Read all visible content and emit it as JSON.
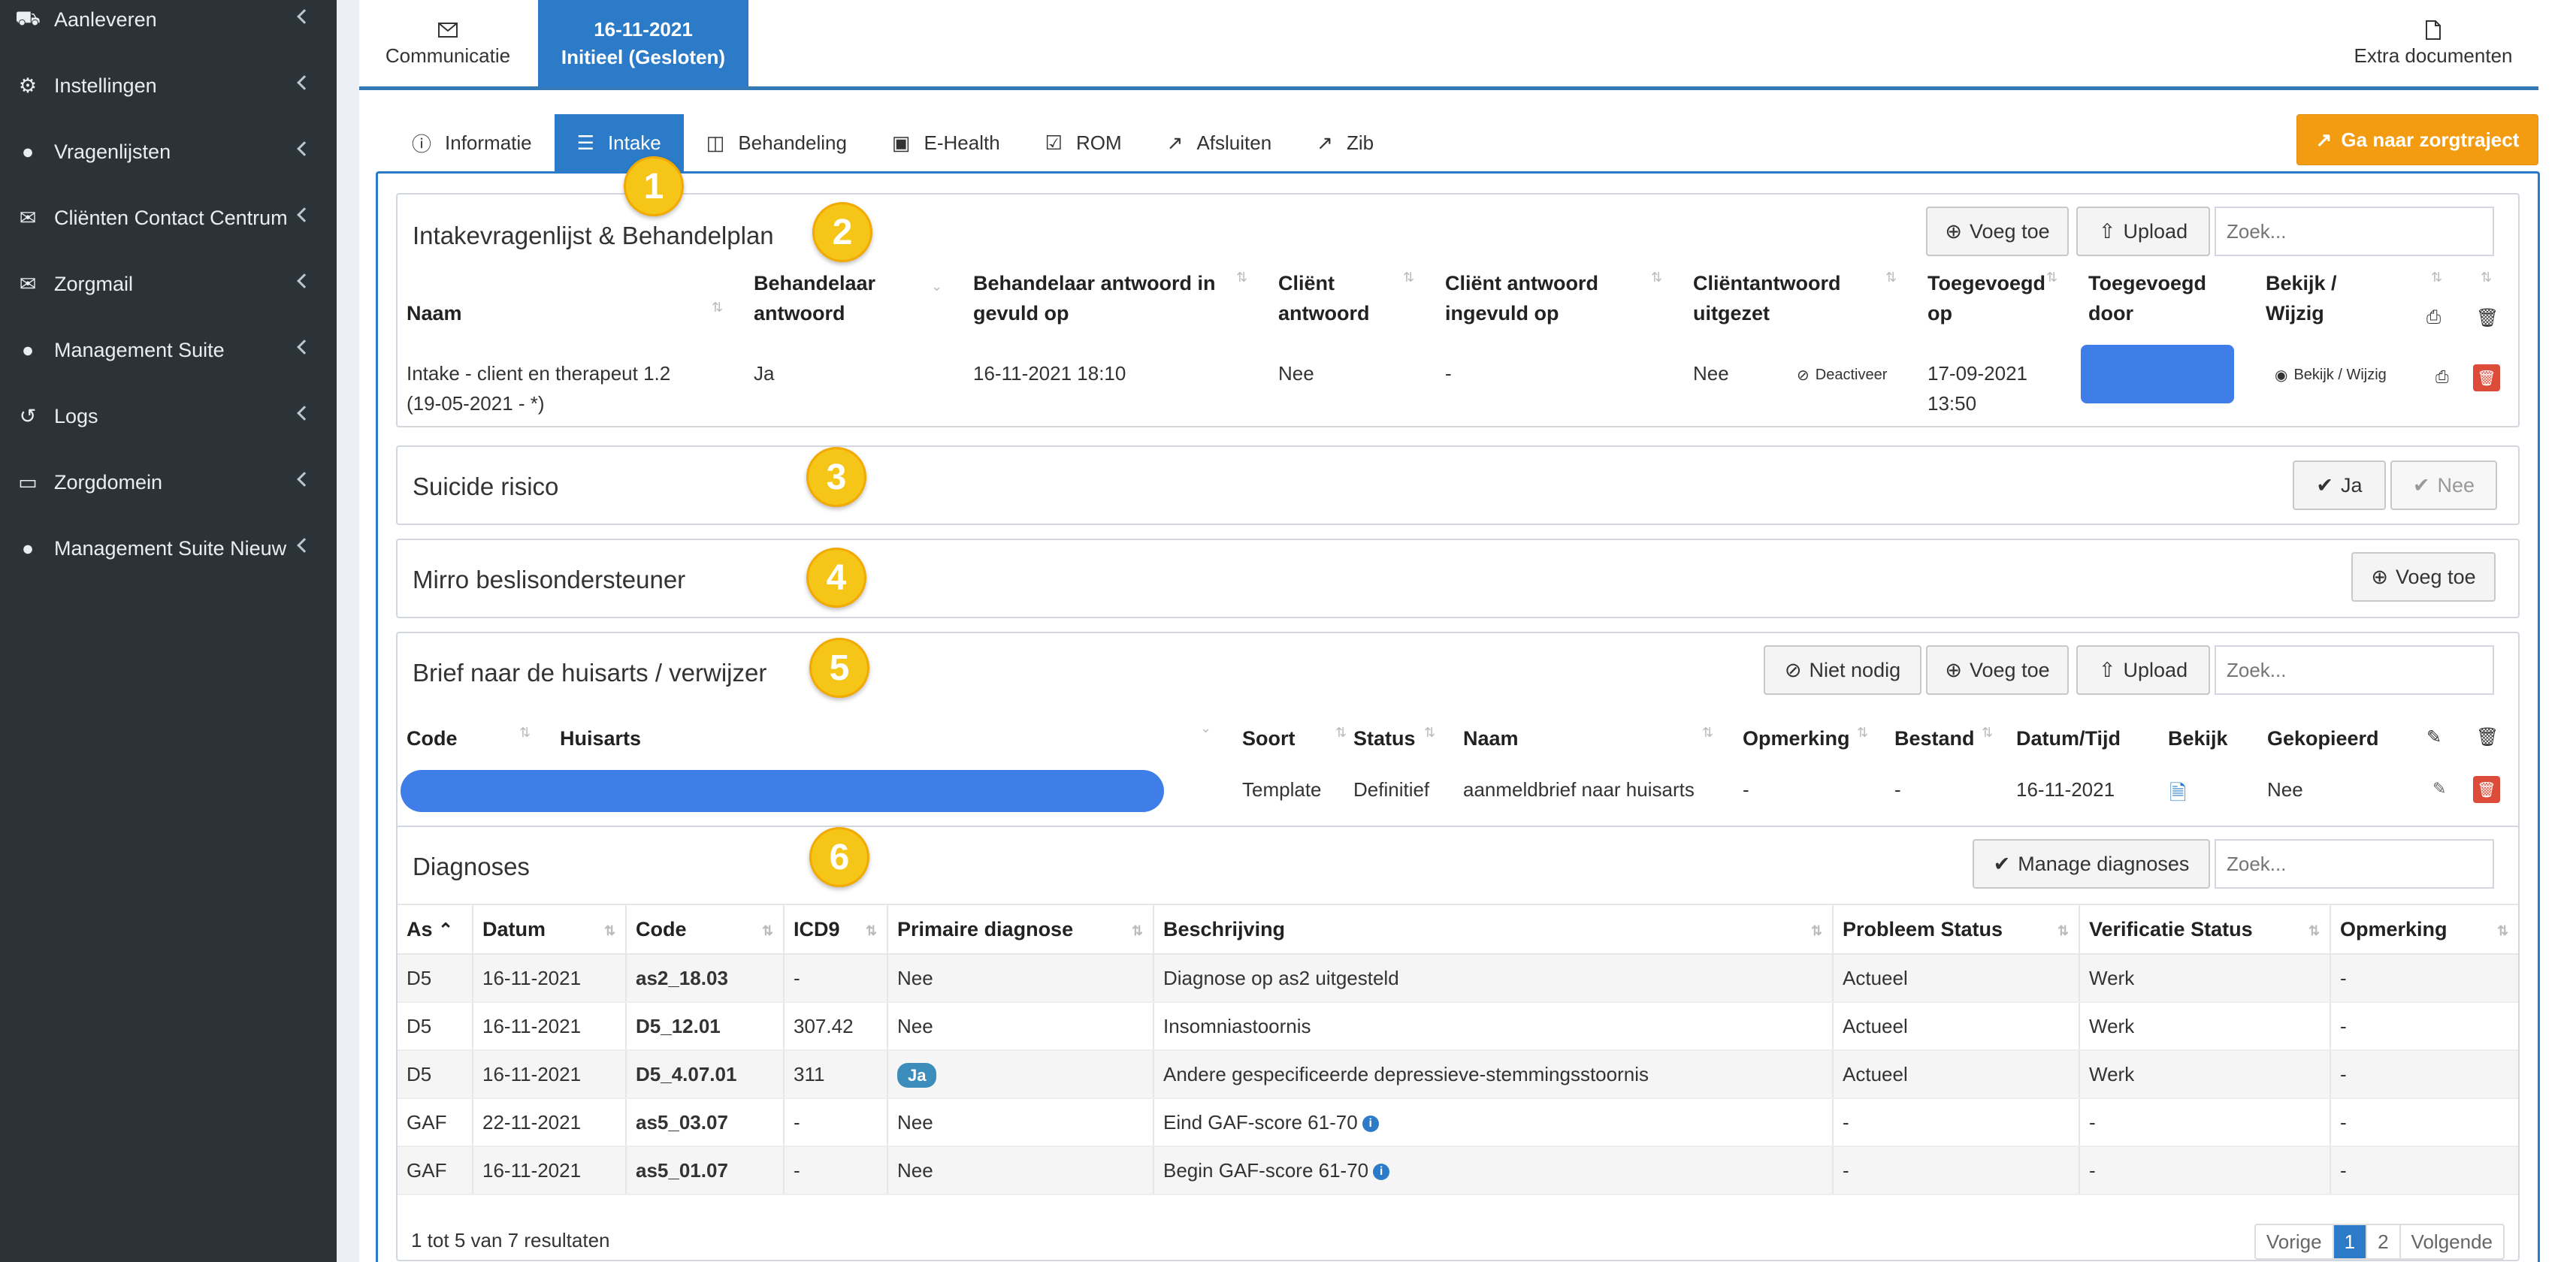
{
  "sidebar": {
    "items": [
      {
        "label": "Aanleveren",
        "icon": "truck-icon"
      },
      {
        "label": "Instellingen",
        "icon": "gear-icon"
      },
      {
        "label": "Vragenlijsten",
        "icon": "globe-icon"
      },
      {
        "label": "Cliënten Contact Centrum",
        "icon": "envelope-icon"
      },
      {
        "label": "Zorgmail",
        "icon": "envelope-icon"
      },
      {
        "label": "Management Suite",
        "icon": "globe-icon"
      },
      {
        "label": "Logs",
        "icon": "history-icon"
      },
      {
        "label": "Zorgdomein",
        "icon": "inbox-icon"
      },
      {
        "label": "Management Suite Nieuw",
        "icon": "globe-icon"
      }
    ]
  },
  "top_tabs": {
    "communicatie": "Communicatie",
    "date": "16-11-2021",
    "status": "Initieel (Gesloten)",
    "extra": "Extra documenten"
  },
  "sub_tabs": [
    "Informatie",
    "Intake",
    "Behandeling",
    "E-Health",
    "ROM",
    "Afsluiten",
    "Zib"
  ],
  "zorgtraject_button": "Ga naar zorgtraject",
  "markers": [
    "1",
    "2",
    "3",
    "4",
    "5",
    "6"
  ],
  "intake": {
    "title": "Intakevragenlijst & Behandelplan",
    "add": "Voeg toe",
    "upload": "Upload",
    "search_placeholder": "Zoek...",
    "headers": {
      "naam": "Naam",
      "beh_antw_1": "Behandelaar",
      "beh_antw_2": "antwoord",
      "beh_ing_1": "Behandelaar antwoord in",
      "beh_ing_2": "gevuld op",
      "cl_antw_1": "Cliënt",
      "cl_antw_2": "antwoord",
      "cl_ing_1": "Cliënt antwoord",
      "cl_ing_2": "ingevuld op",
      "cl_uit_1": "Cliëntantwoord",
      "cl_uit_2": "uitgezet",
      "toe_op_1": "Toegevoegd",
      "toe_op_2": "op",
      "toe_door_1": "Toegevoegd",
      "toe_door_2": "door",
      "bekijk_1": "Bekijk /",
      "bekijk_2": "Wijzig"
    },
    "row": {
      "naam_1": "Intake - client en therapeut 1.2",
      "naam_2": "(19-05-2021 - *)",
      "beh_antw": "Ja",
      "beh_ing": "16-11-2021 18:10",
      "cl_antw": "Nee",
      "cl_ing": "-",
      "cl_uit": "Nee",
      "deactiveer": "Deactiveer",
      "toe_op_1": "17-09-2021",
      "toe_op_2": "13:50",
      "bekijk": "Bekijk / Wijzig"
    }
  },
  "suicide": {
    "title": "Suicide risico",
    "ja": "Ja",
    "nee": "Nee"
  },
  "mirro": {
    "title": "Mirro beslisondersteuner",
    "add": "Voeg toe"
  },
  "brief": {
    "title": "Brief naar de huisarts / verwijzer",
    "niet_nodig": "Niet nodig",
    "add": "Voeg toe",
    "upload": "Upload",
    "search_placeholder": "Zoek...",
    "headers": {
      "code": "Code",
      "huisarts": "Huisarts",
      "soort": "Soort",
      "status": "Status",
      "naam": "Naam",
      "opmerking": "Opmerking",
      "bestand": "Bestand",
      "datum": "Datum/Tijd",
      "bekijk": "Bekijk",
      "gekopieerd": "Gekopieerd"
    },
    "row": {
      "soort": "Template",
      "status": "Definitief",
      "naam": "aanmeldbrief naar huisarts",
      "opmerking": "-",
      "bestand": "-",
      "datum": "16-11-2021",
      "gekopieerd": "Nee"
    }
  },
  "diagnoses": {
    "title": "Diagnoses",
    "manage": "Manage diagnoses",
    "search_placeholder": "Zoek...",
    "headers": [
      "As",
      "Datum",
      "Code",
      "ICD9",
      "Primaire diagnose",
      "Beschrijving",
      "Probleem Status",
      "Verificatie Status",
      "Opmerking"
    ],
    "rows": [
      {
        "as": "D5",
        "datum": "16-11-2021",
        "code": "as2_18.03",
        "icd9": "-",
        "primair": "Nee",
        "beschrijving": "Diagnose op as2 uitgesteld",
        "probleem": "Actueel",
        "verificatie": "Werk",
        "opmerking": "-",
        "info": false
      },
      {
        "as": "D5",
        "datum": "16-11-2021",
        "code": "D5_12.01",
        "icd9": "307.42",
        "primair": "Nee",
        "beschrijving": "Insomniastoornis",
        "probleem": "Actueel",
        "verificatie": "Werk",
        "opmerking": "-",
        "info": false
      },
      {
        "as": "D5",
        "datum": "16-11-2021",
        "code": "D5_4.07.01",
        "icd9": "311",
        "primair": "Ja",
        "beschrijving": "Andere gespecificeerde depressieve-stemmingsstoornis",
        "probleem": "Actueel",
        "verificatie": "Werk",
        "opmerking": "-",
        "info": false
      },
      {
        "as": "GAF",
        "datum": "22-11-2021",
        "code": "as5_03.07",
        "icd9": "-",
        "primair": "Nee",
        "beschrijving": "Eind GAF-score 61-70",
        "probleem": "-",
        "verificatie": "-",
        "opmerking": "-",
        "info": true
      },
      {
        "as": "GAF",
        "datum": "16-11-2021",
        "code": "as5_01.07",
        "icd9": "-",
        "primair": "Nee",
        "beschrijving": "Begin GAF-score 61-70",
        "probleem": "-",
        "verificatie": "-",
        "opmerking": "-",
        "info": true
      }
    ],
    "summary": "1 tot 5 van 7 resultaten",
    "pager": {
      "prev": "Vorige",
      "p1": "1",
      "p2": "2",
      "next": "Volgende"
    }
  }
}
